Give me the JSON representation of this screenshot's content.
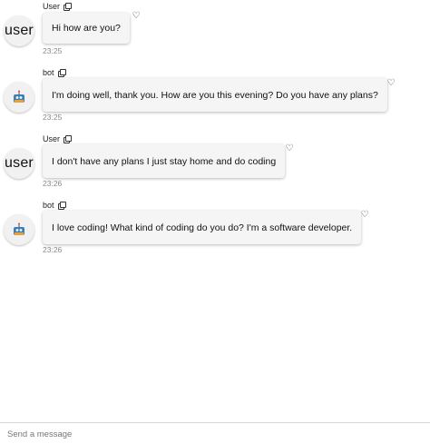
{
  "messages": [
    {
      "sender": "User",
      "avatar": "user",
      "text": "Hi how are you?",
      "time": "23:25"
    },
    {
      "sender": "bot",
      "avatar": "robot-icon",
      "text": "I'm doing well, thank you. How are you this evening? Do you have any plans?",
      "time": "23:25"
    },
    {
      "sender": "User",
      "avatar": "user",
      "text": "I don't have any plans I just stay home and do coding",
      "time": "23:26"
    },
    {
      "sender": "bot",
      "avatar": "robot-icon",
      "text": "I love coding! What kind of coding do you do? I'm a software developer.",
      "time": "23:26"
    }
  ],
  "composer": {
    "placeholder": "Send a message"
  }
}
